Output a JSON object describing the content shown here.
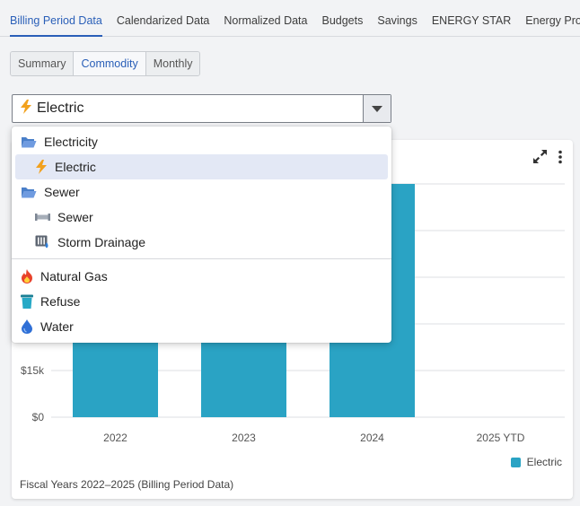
{
  "tabs": [
    {
      "label": "Billing Period Data",
      "active": true
    },
    {
      "label": "Calendarized Data",
      "active": false
    },
    {
      "label": "Normalized Data",
      "active": false
    },
    {
      "label": "Budgets",
      "active": false
    },
    {
      "label": "Savings",
      "active": false
    },
    {
      "label": "ENERGY STAR",
      "active": false
    },
    {
      "label": "Energy Projects",
      "active": false
    }
  ],
  "view_toggle": {
    "options": [
      "Summary",
      "Commodity",
      "Monthly"
    ],
    "selected": "Commodity"
  },
  "commodity_select": {
    "value": "Electric",
    "icon": "lightning-icon"
  },
  "menu": {
    "groups": [
      {
        "label": "Electricity",
        "icon": "folder-open-icon",
        "children": [
          {
            "label": "Electric",
            "icon": "lightning-icon",
            "selected": true
          }
        ]
      },
      {
        "label": "Sewer",
        "icon": "folder-open-icon",
        "children": [
          {
            "label": "Sewer",
            "icon": "pipe-icon",
            "selected": false
          },
          {
            "label": "Storm Drainage",
            "icon": "storm-drain-icon",
            "selected": false
          }
        ]
      }
    ],
    "others": [
      {
        "label": "Natural Gas",
        "icon": "flame-icon"
      },
      {
        "label": "Refuse",
        "icon": "trash-bin-icon"
      },
      {
        "label": "Water",
        "icon": "water-drop-icon"
      }
    ]
  },
  "chart_data": {
    "type": "bar",
    "categories": [
      "2022",
      "2023",
      "2024",
      "2025 YTD"
    ],
    "series": [
      {
        "name": "Electric",
        "values": [
          null,
          null,
          75000,
          0
        ]
      }
    ],
    "y_ticks_visible": [
      "$0",
      "$15k"
    ],
    "ylim": [
      0,
      75000
    ],
    "grid": true,
    "legend": "bottom-right",
    "footnote": "Fiscal Years 2022–2025 (Billing Period Data)"
  },
  "colors": {
    "accent": "#2a5fb8",
    "bar": "#2aa3c4"
  }
}
